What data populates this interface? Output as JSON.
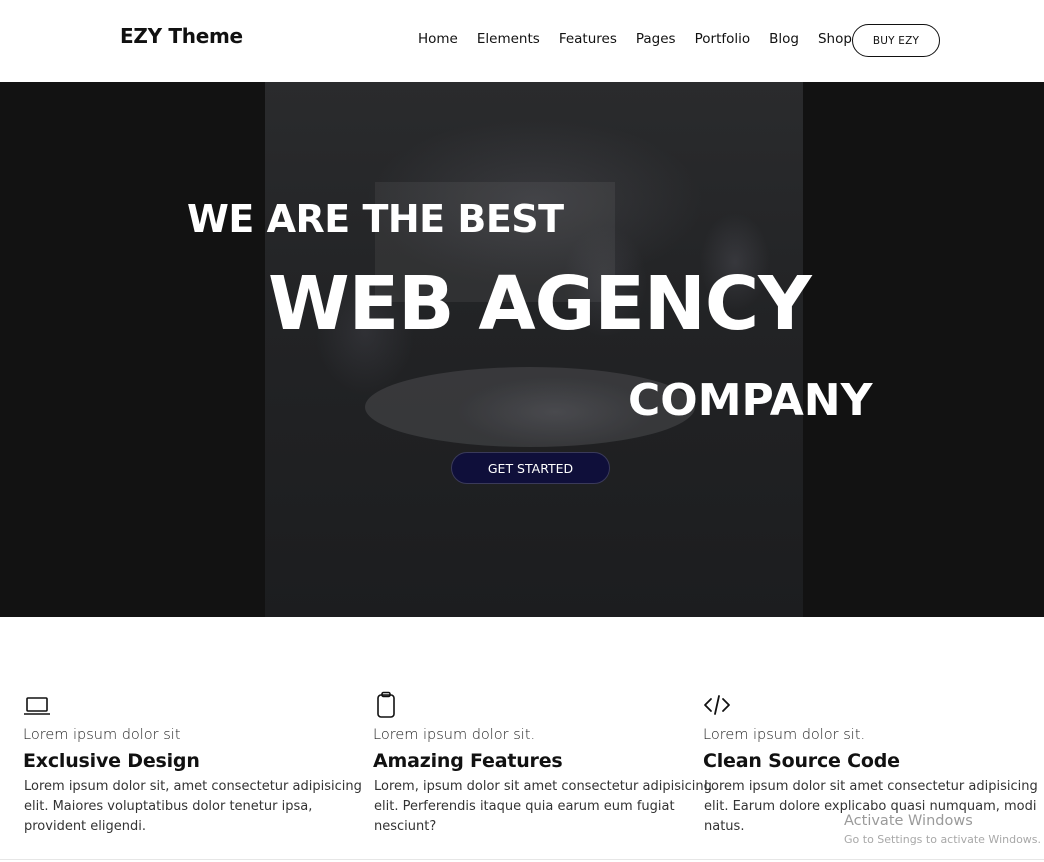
{
  "brand": {
    "name": "EZY Theme"
  },
  "nav": {
    "items": [
      "Home",
      "Elements",
      "Features",
      "Pages",
      "Portfolio",
      "Blog",
      "Shop"
    ],
    "buy_label": "BUY EZY"
  },
  "hero": {
    "line1": "WE ARE THE BEST",
    "line2": "WEB AGENCY",
    "line3": "COMPANY",
    "cta_label": "GET STARTED"
  },
  "features": [
    {
      "icon": "laptop-icon",
      "subtitle": "Lorem ipsum dolor sit",
      "title": "Exclusive Design",
      "description": "Lorem ipsum dolor sit, amet consectetur adipisicing elit. Maiores voluptatibus dolor tenetur ipsa, provident eligendi."
    },
    {
      "icon": "clipboard-icon",
      "subtitle": "Lorem ipsum dolor sit.",
      "title": "Amazing Features",
      "description": "Lorem, ipsum dolor sit amet consectetur adipisicing elit. Perferendis itaque quia earum eum fugiat nesciunt?"
    },
    {
      "icon": "code-icon",
      "subtitle": "Lorem ipsum dolor sit.",
      "title": "Clean Source Code",
      "description": "Lorem ipsum dolor sit amet consectetur adipisicing elit. Earum dolore explicabo quasi numquam, modi natus."
    }
  ],
  "watermark": {
    "title": "Activate Windows",
    "subtitle": "Go to Settings to activate Windows."
  },
  "colors": {
    "hero_background": "#121212",
    "cta_background": "#0f0f3a",
    "text": "#111111"
  }
}
